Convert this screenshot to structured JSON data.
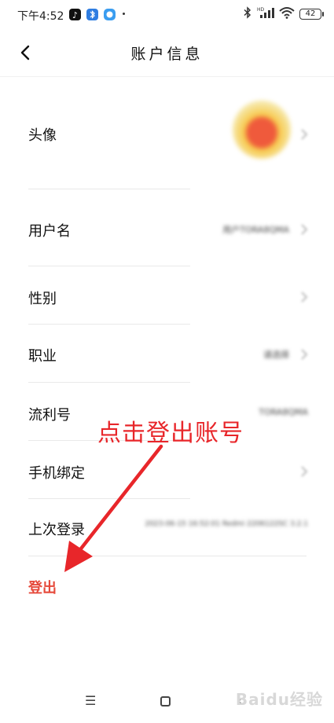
{
  "status_bar": {
    "time": "下午4:52",
    "battery": "42",
    "apps": [
      "tiktok-icon",
      "bluetooth-app-icon",
      "browser-app-icon"
    ]
  },
  "header": {
    "title": "账户信息"
  },
  "rows": {
    "avatar_label": "头像",
    "username_label": "用户名",
    "username_value": "用户TORA8QMA",
    "gender_label": "性别",
    "job_label": "职业",
    "job_value": "请选择",
    "liuli_label": "流利号",
    "liuli_value": "TORA8QMA",
    "phone_label": "手机绑定",
    "last_login_label": "上次登录",
    "last_login_value": "2023-06-15 16:52:01 Redmi 2206122SC 3.2.1"
  },
  "logout_label": "登出",
  "annotation": {
    "text": "点击登出账号",
    "color": "#e8262a"
  },
  "watermark": "Baidu经验",
  "colors": {
    "logout": "#e64a3b",
    "annotation": "#e8262a"
  }
}
